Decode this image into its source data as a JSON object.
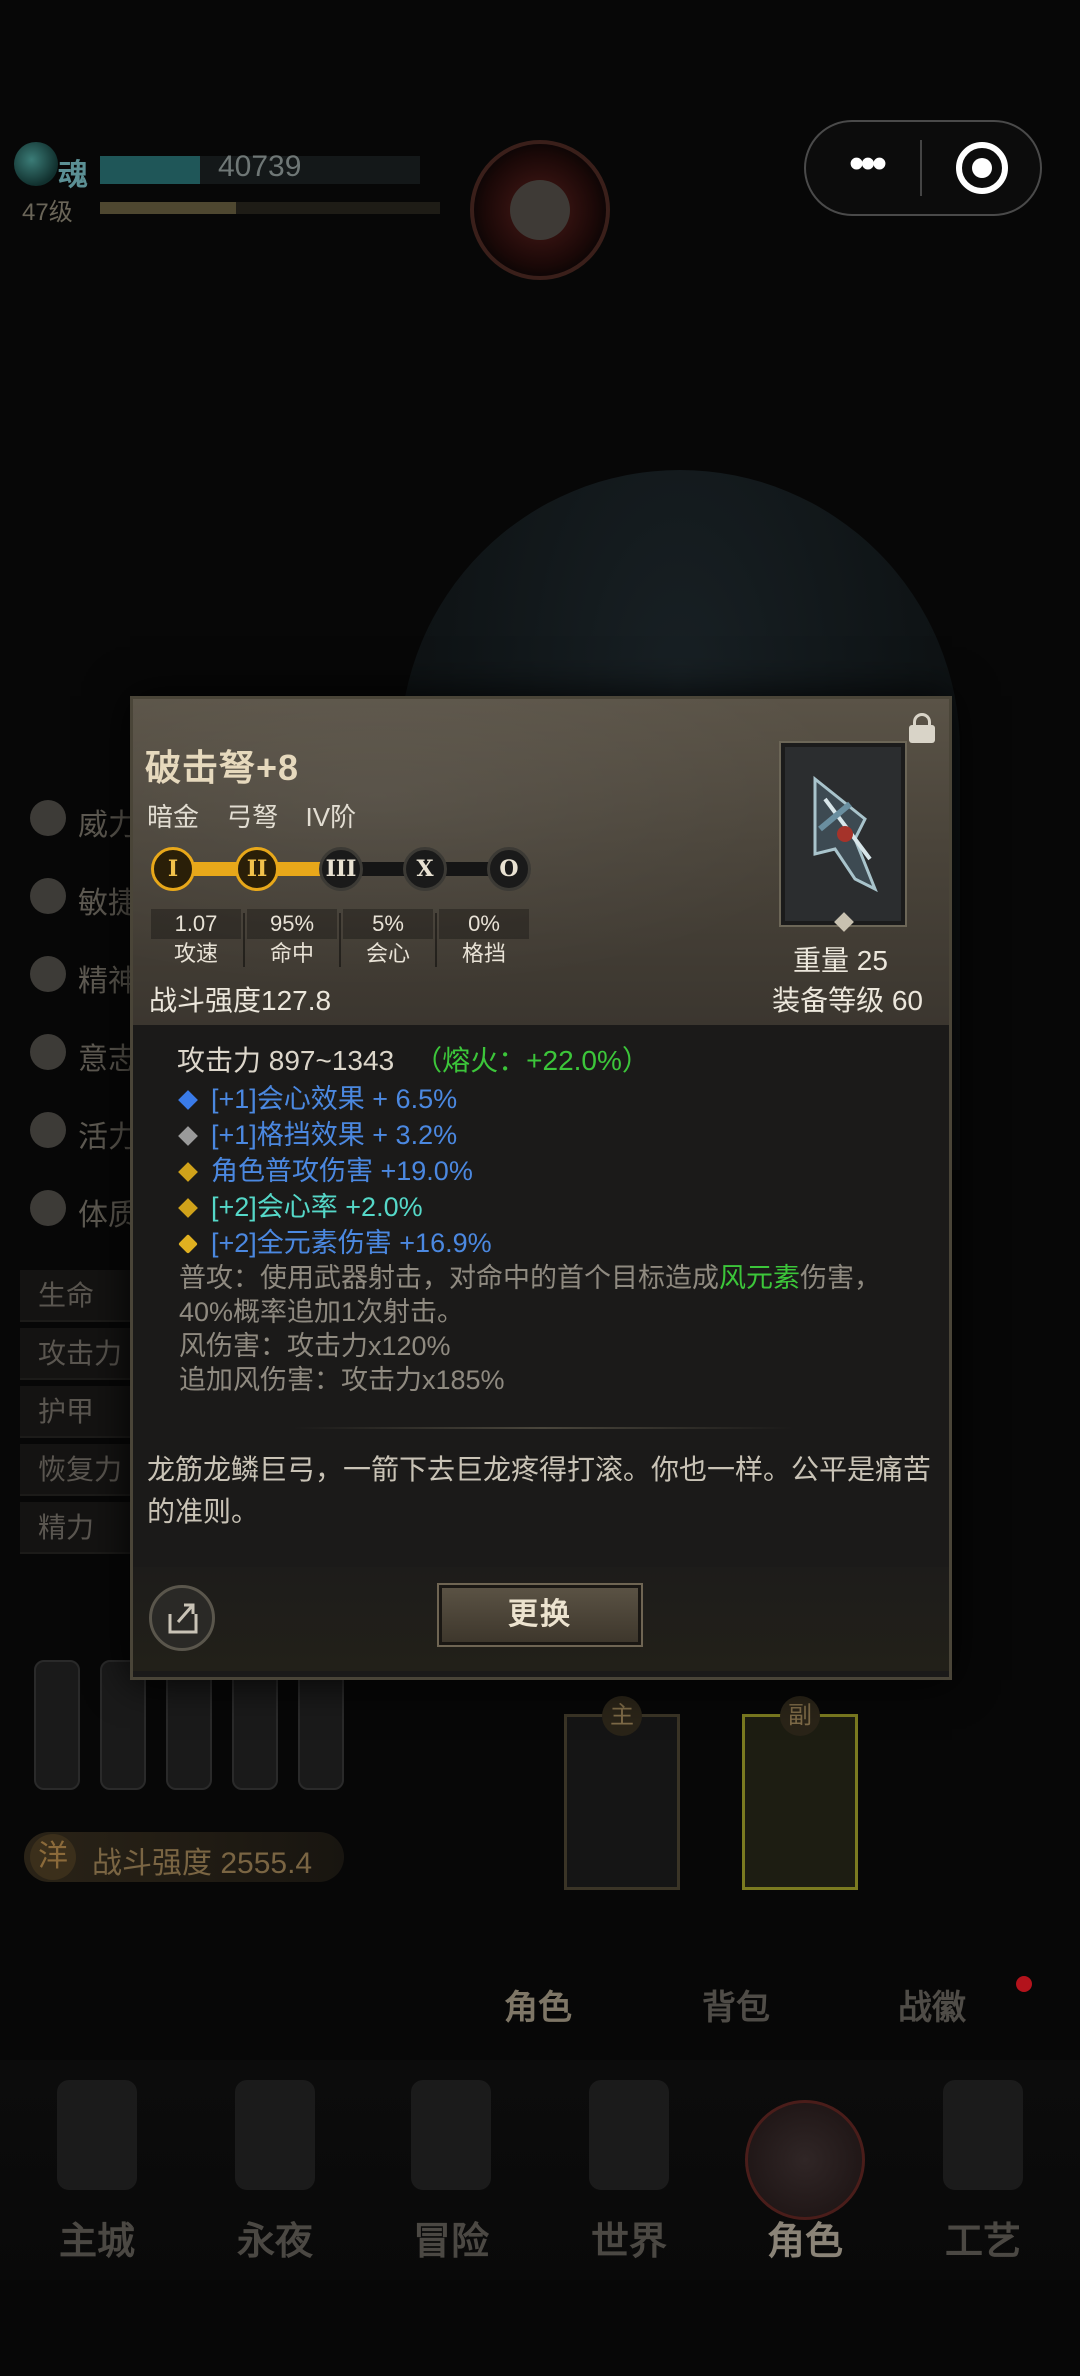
{
  "topbar": {
    "soul_label": "魂",
    "soul_value": "40739",
    "level": "47级"
  },
  "capsule": {
    "more_label": "•••"
  },
  "left_panel": {
    "stats": [
      "威力",
      "敏捷",
      "精神",
      "意志",
      "活力",
      "体质"
    ],
    "attributes": [
      "生命",
      "攻击力",
      "护甲",
      "恢复力",
      "精力"
    ],
    "combat_power": "战斗强度 2555.4",
    "combat_power_icon": "洋"
  },
  "slots": {
    "main_tag": "主",
    "sub_tag": "副"
  },
  "tabs": [
    {
      "label": "角色",
      "active": true
    },
    {
      "label": "背包",
      "active": false
    },
    {
      "label": "战徽",
      "active": false
    }
  ],
  "bottom_nav": [
    {
      "label": "主城",
      "icon": "castle-icon"
    },
    {
      "label": "永夜",
      "icon": "night-icon"
    },
    {
      "label": "冒险",
      "icon": "adventure-icon"
    },
    {
      "label": "世界",
      "icon": "world-wheel-icon"
    },
    {
      "label": "角色",
      "icon": "helmet-icon",
      "active": true
    },
    {
      "label": "工艺",
      "icon": "anvil-icon"
    }
  ],
  "item": {
    "name": "破击弩+8",
    "quality": "暗金",
    "type": "弓弩",
    "tier": "IV阶",
    "ranks": [
      "I",
      "II",
      "III",
      "X",
      "O"
    ],
    "ranks_unlocked": 2,
    "stats": [
      {
        "value": "1.07",
        "label": "攻速"
      },
      {
        "value": "95%",
        "label": "命中"
      },
      {
        "value": "5%",
        "label": "会心"
      },
      {
        "value": "0%",
        "label": "格挡"
      }
    ],
    "combat_power": "战斗强度127.8",
    "weight": "重量 25",
    "equip_level": "装备等级 60",
    "attack": "攻击力 897~1343",
    "attack_bonus": "（熔火：+22.0%）",
    "affixes": [
      {
        "text": "[+1]会心效果 + 6.5%",
        "color": "blue",
        "bullet_color": "#3a7be8"
      },
      {
        "text": "[+1]格挡效果 + 3.2%",
        "color": "blue",
        "bullet_color": "#9a9a9a"
      },
      {
        "text": "角色普攻伤害 +19.0%",
        "color": "blue",
        "bullet_color": "#d0a21a"
      },
      {
        "text": "[+2]会心率 +2.0%",
        "color": "teal",
        "bullet_color": "#d0a21a"
      },
      {
        "text": "[+2]全元素伤害 +16.9%",
        "color": "blue",
        "bullet_color": "#e0b020"
      }
    ],
    "skill_prefix": "普攻：使用武器射击，对命中的首个目标造成",
    "skill_element": "风元素",
    "skill_suffix": "伤害，40%概率追加1次射击。",
    "damage_line": "风伤害：攻击力x120%",
    "extra_damage_line": "追加风伤害：攻击力x185%",
    "lore": "龙筋龙鳞巨弓，一箭下去巨龙疼得打滚。你也一样。公平是痛苦的准则。",
    "swap_label": "更换"
  },
  "colors": {
    "accent_gold": "#e8a81a",
    "affix_blue": "#4b88e0",
    "affix_teal": "#55d8c8",
    "element_green": "#3cc63a"
  }
}
